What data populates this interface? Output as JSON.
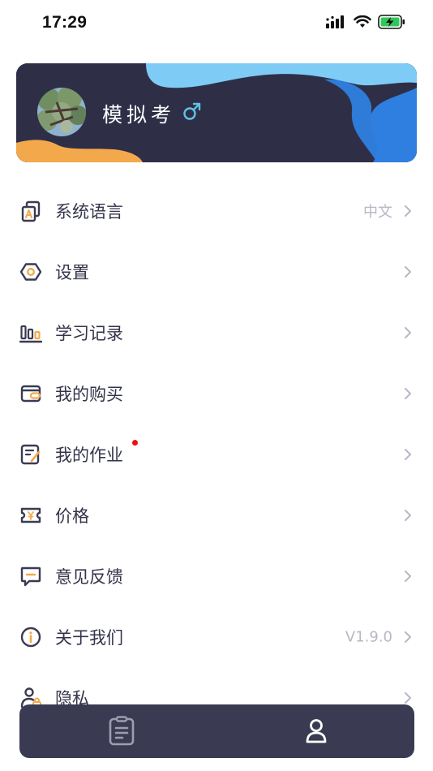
{
  "status_bar": {
    "time": "17:29"
  },
  "profile": {
    "name": "模拟考",
    "gender_symbol": "♂"
  },
  "menu": {
    "items": [
      {
        "label": "系统语言",
        "value": "中文",
        "icon": "language-icon"
      },
      {
        "label": "设置",
        "value": "",
        "icon": "settings-icon"
      },
      {
        "label": "学习记录",
        "value": "",
        "icon": "stats-icon"
      },
      {
        "label": "我的购买",
        "value": "",
        "icon": "wallet-icon"
      },
      {
        "label": "我的作业",
        "value": "",
        "icon": "homework-icon",
        "badge": true
      },
      {
        "label": "价格",
        "value": "",
        "icon": "price-ticket-icon"
      },
      {
        "label": "意见反馈",
        "value": "",
        "icon": "feedback-icon"
      },
      {
        "label": "关于我们",
        "value": "V1.9.0",
        "icon": "info-icon"
      },
      {
        "label": "隐私",
        "value": "",
        "icon": "privacy-icon"
      }
    ]
  },
  "tab_bar": {
    "tabs": [
      {
        "icon": "clipboard-icon",
        "active": false
      },
      {
        "icon": "person-icon",
        "active": true
      }
    ]
  },
  "colors": {
    "card_bg": "#2e2f47",
    "card_blue_light": "#7ecbf6",
    "card_blue_dark": "#2f7fe0",
    "card_orange": "#f3a94b",
    "icon_dark": "#3a3b52",
    "icon_orange": "#f3a94b",
    "badge_red": "#f20d0d",
    "tab_bar_bg": "#3a3b52"
  }
}
